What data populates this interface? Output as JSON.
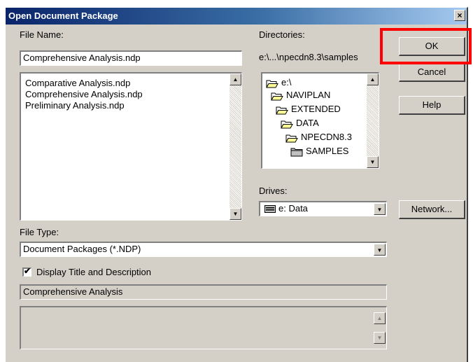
{
  "window": {
    "title": "Open Document Package",
    "close_glyph": "×"
  },
  "file_name": {
    "label": "File Name:",
    "value": "Comprehensive Analysis.ndp",
    "files": [
      "Comparative Analysis.ndp",
      "Comprehensive Analysis.ndp",
      "Preliminary Analysis.ndp"
    ]
  },
  "directories": {
    "label": "Directories:",
    "current_path": "e:\\...\\npecdn8.3\\samples",
    "tree": [
      "e:\\",
      "NAVIPLAN",
      "EXTENDED",
      "DATA",
      "NPECDN8.3",
      "SAMPLES"
    ]
  },
  "drives": {
    "label": "Drives:",
    "selected": "e: Data"
  },
  "file_type": {
    "label": "File Type:",
    "selected": "Document Packages (*.NDP)"
  },
  "display_title": {
    "label": "Display Title and Description",
    "checked": true,
    "check_glyph": "✔"
  },
  "title_value": "Comprehensive Analysis",
  "description_value": "",
  "buttons": {
    "ok": "OK",
    "cancel": "Cancel",
    "help": "Help",
    "network": "Network..."
  },
  "glyphs": {
    "up": "▲",
    "down": "▼"
  },
  "colors": {
    "highlight": "#ff0000",
    "titlebar": "#0a246a",
    "face": "#d4d0c8"
  }
}
